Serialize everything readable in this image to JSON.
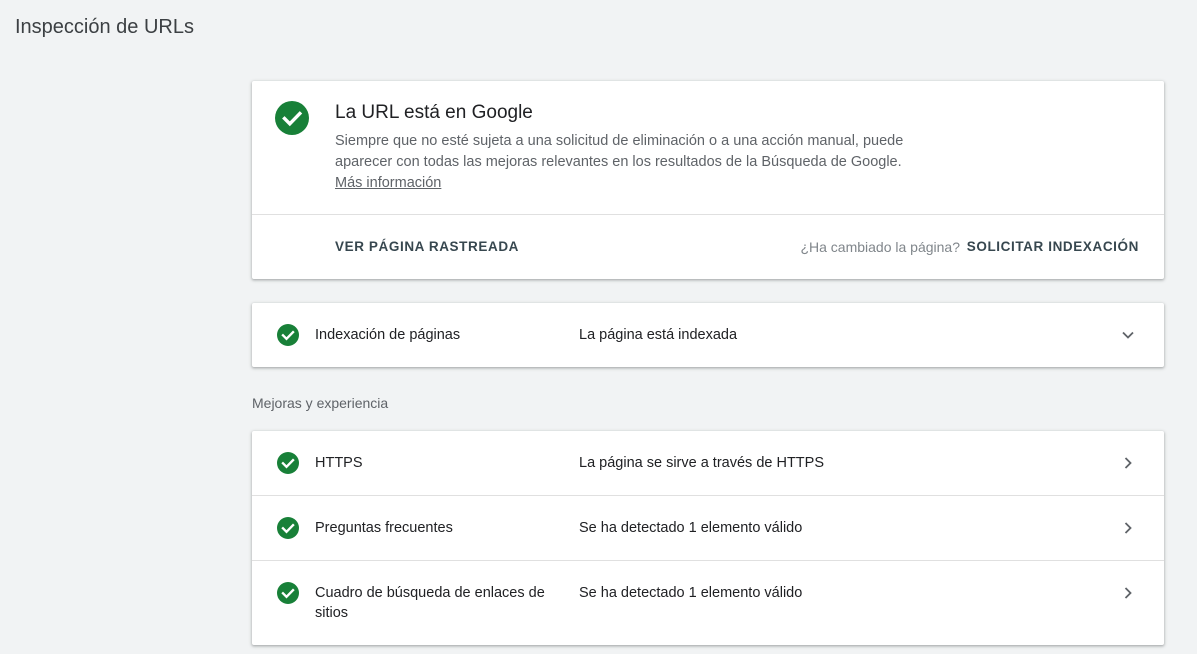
{
  "page": {
    "title": "Inspección de URLs"
  },
  "status_card": {
    "heading": "La URL está en Google",
    "description": "Siempre que no esté sujeta a una solicitud de eliminación o a una acción manual, puede aparecer con todas las mejoras relevantes en los resultados de la Búsqueda de Google. ",
    "more_info_link": "Más información",
    "view_crawled_button": "VER PÁGINA RASTREADA",
    "changed_question": "¿Ha cambiado la página?",
    "request_indexing_button": "SOLICITAR INDEXACIÓN",
    "icon": "check-circle-icon"
  },
  "indexing": {
    "label": "Indexación de páginas",
    "value": "La página está indexada",
    "icon": "check-circle-icon",
    "expand_icon": "chevron-down-icon"
  },
  "enhancements": {
    "section_title": "Mejoras y experiencia",
    "items": [
      {
        "label": "HTTPS",
        "value": "La página se sirve a través de HTTPS"
      },
      {
        "label": "Preguntas frecuentes",
        "value": "Se ha detectado 1 elemento válido"
      },
      {
        "label": "Cuadro de búsqueda de enlaces de sitios",
        "value": "Se ha detectado 1 elemento válido"
      }
    ]
  },
  "colors": {
    "success_green": "#188038",
    "background": "#f1f3f4",
    "button_text": "#37474f"
  }
}
